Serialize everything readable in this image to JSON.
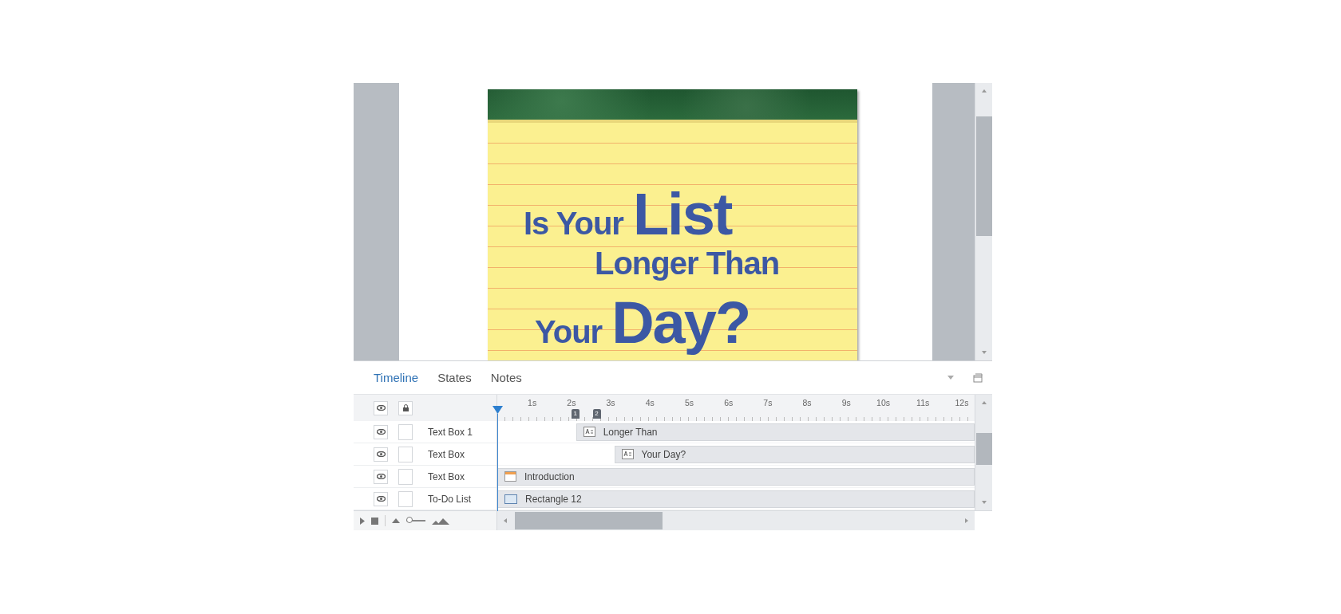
{
  "slide": {
    "lines": [
      [
        {
          "text": "Is Your",
          "kind": "normal"
        },
        {
          "text": "List",
          "kind": "big"
        }
      ],
      [
        {
          "text": "Longer Than",
          "kind": "normal"
        }
      ],
      [
        {
          "text": "Your",
          "kind": "normal"
        },
        {
          "text": "Day?",
          "kind": "big"
        }
      ]
    ]
  },
  "tabs": [
    {
      "label": "Timeline",
      "selected": true
    },
    {
      "label": "States",
      "selected": false
    },
    {
      "label": "Notes",
      "selected": false
    }
  ],
  "ruler": {
    "labels": [
      "1s",
      "2s",
      "3s",
      "4s",
      "5s",
      "6s",
      "7s",
      "8s",
      "9s",
      "10s",
      "11s",
      "12s"
    ],
    "markers": [
      {
        "label": "1",
        "level": 0.155
      },
      {
        "label": "2",
        "level": 0.2
      }
    ]
  },
  "layers": [
    {
      "name": "Text Box 1",
      "visible": true,
      "locked": false,
      "clip": {
        "label": "Longer Than",
        "kind": "text",
        "level": 0.835
      }
    },
    {
      "name": "Text Box",
      "visible": true,
      "locked": false,
      "clip": {
        "label": "Your Day?",
        "kind": "text",
        "level": 0.755
      }
    },
    {
      "name": "Text Box",
      "visible": true,
      "locked": false,
      "clip": {
        "label": "Introduction",
        "kind": "slide",
        "level": 1
      }
    },
    {
      "name": "To-Do List",
      "visible": true,
      "locked": false,
      "clip": {
        "label": "Rectangle 12",
        "kind": "shape",
        "level": 1
      }
    }
  ],
  "zoom_slider": {
    "level": 0.15
  }
}
